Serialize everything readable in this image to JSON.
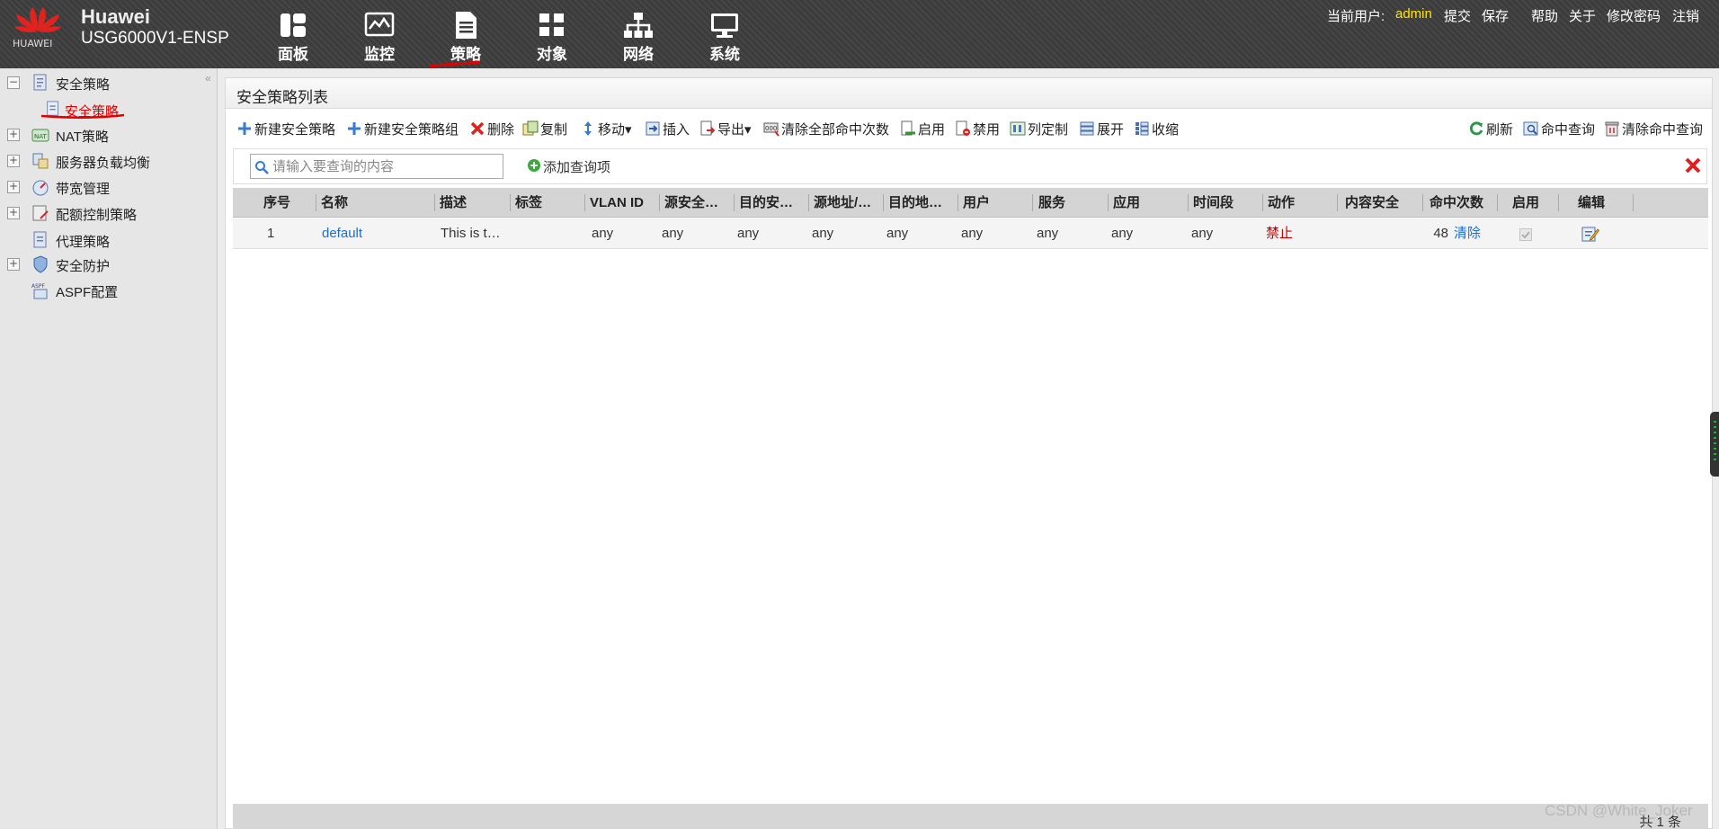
{
  "header": {
    "brand": "Huawei",
    "logo_text": "HUAWEI",
    "model": "USG6000V1-ENSP",
    "nav": [
      {
        "label": "面板",
        "icon": "dashboard-icon"
      },
      {
        "label": "监控",
        "icon": "monitor-icon"
      },
      {
        "label": "策略",
        "icon": "policy-document-icon"
      },
      {
        "label": "对象",
        "icon": "object-icon"
      },
      {
        "label": "网络",
        "icon": "network-icon"
      },
      {
        "label": "系统",
        "icon": "system-icon"
      }
    ],
    "active_nav": "策略",
    "user_label": "当前用户:",
    "username": "admin",
    "links": [
      "提交",
      "保存",
      "帮助",
      "关于",
      "修改密码",
      "注销"
    ],
    "user_color": "#ffe600"
  },
  "sidebar": {
    "collapse_glyph": "«",
    "items": [
      {
        "label": "安全策略",
        "expand": "−",
        "icon": "security-policy-icon"
      },
      {
        "label": "安全策略",
        "icon": "policy-page-icon",
        "selected": true
      },
      {
        "label": "NAT策略",
        "expand": "+",
        "icon": "nat-icon"
      },
      {
        "label": "服务器负载均衡",
        "expand": "+",
        "icon": "load-balance-icon"
      },
      {
        "label": "带宽管理",
        "expand": "+",
        "icon": "bandwidth-icon"
      },
      {
        "label": "配额控制策略",
        "expand": "+",
        "icon": "quota-icon"
      },
      {
        "label": "代理策略",
        "icon": "proxy-icon"
      },
      {
        "label": "安全防护",
        "expand": "+",
        "icon": "shield-icon"
      },
      {
        "label": "ASPF配置",
        "icon": "aspf-icon"
      }
    ]
  },
  "panel": {
    "title": "安全策略列表",
    "toolbar_left": [
      {
        "label": "新建安全策略",
        "icon": "add-icon"
      },
      {
        "label": "新建安全策略组",
        "icon": "add-icon"
      },
      {
        "label": "删除",
        "icon": "delete-icon"
      },
      {
        "label": "复制",
        "icon": "copy-icon"
      },
      {
        "label": "移动▾",
        "icon": "move-icon"
      },
      {
        "label": "插入",
        "icon": "insert-icon"
      },
      {
        "label": "导出▾",
        "icon": "export-icon"
      },
      {
        "label": "清除全部命中次数",
        "icon": "clear-hits-icon"
      },
      {
        "label": "启用",
        "icon": "enable-icon"
      },
      {
        "label": "禁用",
        "icon": "disable-icon"
      },
      {
        "label": "列定制",
        "icon": "column-custom-icon"
      },
      {
        "label": "展开",
        "icon": "expand-icon"
      },
      {
        "label": "收缩",
        "icon": "collapse-icon"
      }
    ],
    "toolbar_right": [
      {
        "label": "刷新",
        "icon": "refresh-icon"
      },
      {
        "label": "命中查询",
        "icon": "hit-query-icon"
      },
      {
        "label": "清除命中查询",
        "icon": "clear-hit-query-icon"
      }
    ],
    "search_placeholder": "请输入要查询的内容",
    "add_query_label": "添加查询项",
    "columns": [
      "序号",
      "名称",
      "描述",
      "标签",
      "VLAN ID",
      "源安全…",
      "目的安…",
      "源地址/…",
      "目的地…",
      "用户",
      "服务",
      "应用",
      "时间段",
      "动作",
      "内容安全",
      "命中次数",
      "启用",
      "编辑"
    ],
    "rows": [
      {
        "index": "1",
        "name": "default",
        "description": "This is t…",
        "tag": "",
        "vlan": "any",
        "src_zone": "any",
        "dst_zone": "any",
        "src_addr": "any",
        "dst_addr": "any",
        "user": "any",
        "service": "any",
        "app": "any",
        "time": "any",
        "action": "禁止",
        "content_security": "",
        "hits": "48",
        "clear_label": "清除",
        "enabled": true
      }
    ],
    "footer_text": "共 1 条"
  },
  "watermark": "CSDN @White_Joker",
  "colors": {
    "deny": "#c00000",
    "link": "#1a6fd1",
    "header_bg": "#3c3c3c",
    "annotation_red": "#e00000"
  }
}
